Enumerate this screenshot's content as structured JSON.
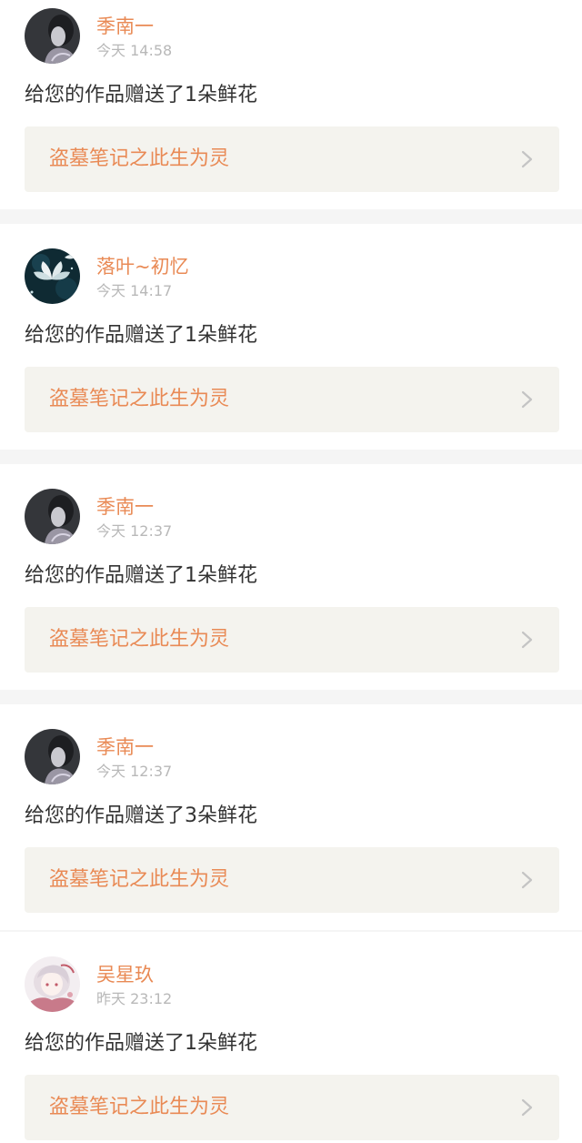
{
  "notifications": [
    {
      "username": "季南一",
      "time": "今天 14:58",
      "message": "给您的作品赠送了1朵鲜花",
      "work_title": "盗墓笔记之此生为灵",
      "avatar_icon": "dark-portrait-avatar"
    },
    {
      "username": "落叶~初忆",
      "time": "今天 14:17",
      "message": "给您的作品赠送了1朵鲜花",
      "work_title": "盗墓笔记之此生为灵",
      "avatar_icon": "lotus-flower-avatar"
    },
    {
      "username": "季南一",
      "time": "今天 12:37",
      "message": "给您的作品赠送了1朵鲜花",
      "work_title": "盗墓笔记之此生为灵",
      "avatar_icon": "dark-portrait-avatar"
    },
    {
      "username": "季南一",
      "time": "今天 12:37",
      "message": "给您的作品赠送了3朵鲜花",
      "work_title": "盗墓笔记之此生为灵",
      "avatar_icon": "dark-portrait-avatar"
    },
    {
      "username": "吴星玖",
      "time": "昨天 23:12",
      "message": "给您的作品赠送了1朵鲜花",
      "work_title": "盗墓笔记之此生为灵",
      "avatar_icon": "anime-girl-avatar"
    }
  ],
  "colors": {
    "accent": "#e98a55",
    "time_text": "#b8b8b8",
    "message_text": "#333333",
    "link_background": "#f4f3ee",
    "separator": "#f5f5f5"
  },
  "icons": {
    "chevron": "chevron-right-icon"
  }
}
